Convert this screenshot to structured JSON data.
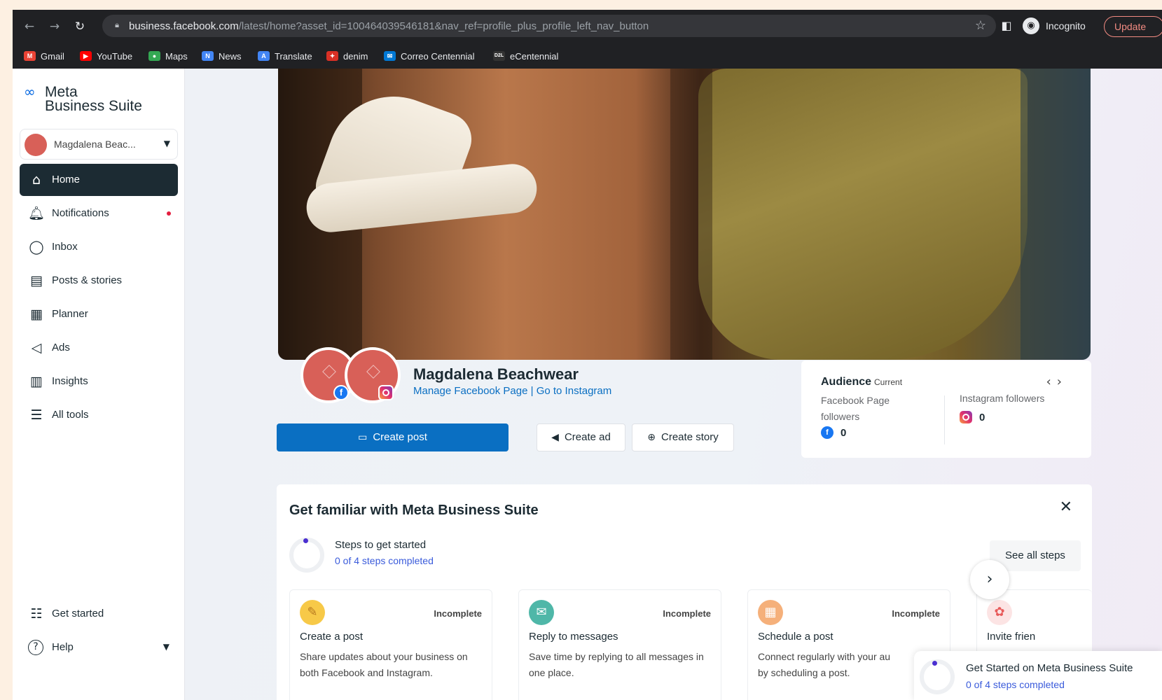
{
  "browser": {
    "url_host": "business.facebook.com",
    "url_path": "/latest/home?asset_id=100464039546181&nav_ref=profile_plus_profile_left_nav_button",
    "incognito_label": "Incognito",
    "update_label": "Update",
    "bookmarks": [
      {
        "label": "Gmail",
        "icon": "gmail-icon",
        "color": "#ea4335",
        "glyph": "M"
      },
      {
        "label": "YouTube",
        "icon": "youtube-icon",
        "color": "#ff0000",
        "glyph": "▶"
      },
      {
        "label": "Maps",
        "icon": "maps-icon",
        "color": "#34a853",
        "glyph": "●"
      },
      {
        "label": "News",
        "icon": "news-icon",
        "color": "#4285f4",
        "glyph": "N"
      },
      {
        "label": "Translate",
        "icon": "translate-icon",
        "color": "#4285f4",
        "glyph": "A"
      },
      {
        "label": "denim",
        "icon": "leaf-icon",
        "color": "#d93025",
        "glyph": "✦"
      },
      {
        "label": "Correo Centennial",
        "icon": "mail-icon",
        "color": "#0078d4",
        "glyph": "✉"
      },
      {
        "label": "eCentennial",
        "icon": "ecentennial-icon",
        "color": "#333333",
        "glyph": "D2L"
      }
    ]
  },
  "sidebar": {
    "brand_line1": "Meta",
    "brand_line2": "Business Suite",
    "account_name": "Magdalena Beac...",
    "items": [
      {
        "label": "Home",
        "icon": "home-icon",
        "glyph": "⌂",
        "active": true
      },
      {
        "label": "Notifications",
        "icon": "bell-icon",
        "glyph": "🔔︎",
        "dot": true
      },
      {
        "label": "Inbox",
        "icon": "chat-bubble-icon",
        "glyph": "◯"
      },
      {
        "label": "Posts & stories",
        "icon": "posts-icon",
        "glyph": "▤"
      },
      {
        "label": "Planner",
        "icon": "calendar-icon",
        "glyph": "▦"
      },
      {
        "label": "Ads",
        "icon": "megaphone-icon",
        "glyph": "◁"
      },
      {
        "label": "Insights",
        "icon": "bar-chart-icon",
        "glyph": "▥"
      },
      {
        "label": "All tools",
        "icon": "menu-icon",
        "glyph": "☰"
      }
    ],
    "bottom_items": [
      {
        "label": "Get started",
        "icon": "checklist-icon",
        "glyph": "☷"
      },
      {
        "label": "Help",
        "icon": "help-icon",
        "glyph": "?"
      }
    ]
  },
  "profile": {
    "page_name": "Magdalena Beachwear",
    "manage_link": "Manage Facebook Page",
    "separator": "|",
    "instagram_link": "Go to Instagram"
  },
  "actions": {
    "create_post": "Create post",
    "create_ad": "Create ad",
    "create_story": "Create story"
  },
  "audience": {
    "title": "Audience",
    "current": "Current",
    "fb_label": "Facebook Page followers",
    "fb_value": "0",
    "ig_label": "Instagram followers",
    "ig_value": "0"
  },
  "familiar": {
    "title": "Get familiar with Meta Business Suite",
    "steps_title": "Steps to get started",
    "steps_progress": "0 of 4 steps completed",
    "see_all": "See all steps",
    "tasks": [
      {
        "title": "Create a post",
        "status": "Incomplete",
        "desc": "Share updates about your business on both Facebook and Instagram.",
        "icon": "pencil-icon",
        "glyph": "✎",
        "color": "#f7c948"
      },
      {
        "title": "Reply to messages",
        "status": "Incomplete",
        "desc": "Save time by replying to all messages in one place.",
        "icon": "message-icon",
        "glyph": "✉",
        "color": "#4fb7a8"
      },
      {
        "title": "Schedule a post",
        "status": "Incomplete",
        "desc": "Connect regularly with your au",
        "desc2": "by scheduling a post.",
        "icon": "schedule-icon",
        "glyph": "▦",
        "color": "#f5b07a"
      },
      {
        "title": "Invite frien",
        "status": "",
        "desc": "",
        "icon": "gift-icon",
        "glyph": "✿",
        "color": "#e85a5a"
      }
    ]
  },
  "toast": {
    "title": "Get Started on Meta Business Suite",
    "progress": "0 of 4 steps completed"
  }
}
